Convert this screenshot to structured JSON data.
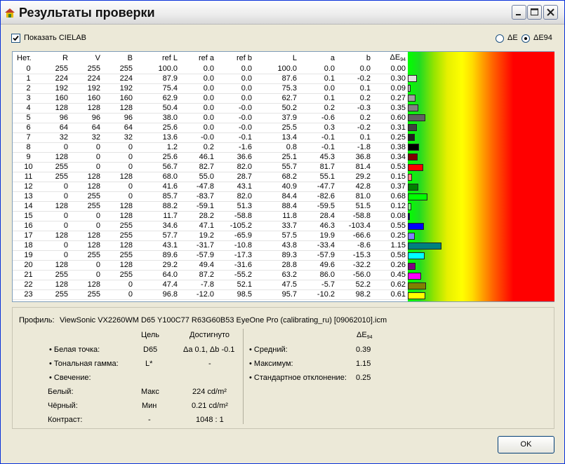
{
  "window": {
    "title": "Результаты проверки"
  },
  "options": {
    "show_cielab_label": "Показать CIELAB",
    "show_cielab_checked": true,
    "radio_de_label": "ΔE",
    "radio_de94_label": "ΔE94",
    "selected": "ΔE94"
  },
  "table": {
    "headers": [
      "Нет.",
      "R",
      "V",
      "B",
      "ref L",
      "ref a",
      "ref b",
      "L",
      "a",
      "b",
      "ΔE"
    ],
    "de_header_sub": "94",
    "rows": [
      [
        "0",
        "255",
        "255",
        "255",
        "100.0",
        "0.0",
        "0.0",
        "100.0",
        "0.0",
        "0.0",
        "0.00"
      ],
      [
        "1",
        "224",
        "224",
        "224",
        "87.9",
        "0.0",
        "0.0",
        "87.6",
        "0.1",
        "-0.2",
        "0.30"
      ],
      [
        "2",
        "192",
        "192",
        "192",
        "75.4",
        "0.0",
        "0.0",
        "75.3",
        "0.0",
        "0.1",
        "0.09"
      ],
      [
        "3",
        "160",
        "160",
        "160",
        "62.9",
        "0.0",
        "0.0",
        "62.7",
        "0.1",
        "0.2",
        "0.27"
      ],
      [
        "4",
        "128",
        "128",
        "128",
        "50.4",
        "0.0",
        "-0.0",
        "50.2",
        "0.2",
        "-0.3",
        "0.35"
      ],
      [
        "5",
        "96",
        "96",
        "96",
        "38.0",
        "0.0",
        "-0.0",
        "37.9",
        "-0.6",
        "0.2",
        "0.60"
      ],
      [
        "6",
        "64",
        "64",
        "64",
        "25.6",
        "0.0",
        "-0.0",
        "25.5",
        "0.3",
        "-0.2",
        "0.31"
      ],
      [
        "7",
        "32",
        "32",
        "32",
        "13.6",
        "-0.0",
        "-0.1",
        "13.4",
        "-0.1",
        "0.1",
        "0.25"
      ],
      [
        "8",
        "0",
        "0",
        "0",
        "1.2",
        "0.2",
        "-1.6",
        "0.8",
        "-0.1",
        "-1.8",
        "0.38"
      ],
      [
        "9",
        "128",
        "0",
        "0",
        "25.6",
        "46.1",
        "36.6",
        "25.1",
        "45.3",
        "36.8",
        "0.34"
      ],
      [
        "10",
        "255",
        "0",
        "0",
        "56.7",
        "82.7",
        "82.0",
        "55.7",
        "81.7",
        "81.4",
        "0.53"
      ],
      [
        "11",
        "255",
        "128",
        "128",
        "68.0",
        "55.0",
        "28.7",
        "68.2",
        "55.1",
        "29.2",
        "0.15"
      ],
      [
        "12",
        "0",
        "128",
        "0",
        "41.6",
        "-47.8",
        "43.1",
        "40.9",
        "-47.7",
        "42.8",
        "0.37"
      ],
      [
        "13",
        "0",
        "255",
        "0",
        "85.7",
        "-83.7",
        "82.0",
        "84.4",
        "-82.6",
        "81.0",
        "0.68"
      ],
      [
        "14",
        "128",
        "255",
        "128",
        "88.2",
        "-59.1",
        "51.3",
        "88.4",
        "-59.5",
        "51.5",
        "0.12"
      ],
      [
        "15",
        "0",
        "0",
        "128",
        "11.7",
        "28.2",
        "-58.8",
        "11.8",
        "28.4",
        "-58.8",
        "0.08"
      ],
      [
        "16",
        "0",
        "0",
        "255",
        "34.6",
        "47.1",
        "-105.2",
        "33.7",
        "46.3",
        "-103.4",
        "0.55"
      ],
      [
        "17",
        "128",
        "128",
        "255",
        "57.7",
        "19.2",
        "-65.9",
        "57.5",
        "19.9",
        "-66.6",
        "0.25"
      ],
      [
        "18",
        "0",
        "128",
        "128",
        "43.1",
        "-31.7",
        "-10.8",
        "43.8",
        "-33.4",
        "-8.6",
        "1.15"
      ],
      [
        "19",
        "0",
        "255",
        "255",
        "89.6",
        "-57.9",
        "-17.3",
        "89.3",
        "-57.9",
        "-15.3",
        "0.58"
      ],
      [
        "20",
        "128",
        "0",
        "128",
        "29.2",
        "49.4",
        "-31.6",
        "28.8",
        "49.6",
        "-32.2",
        "0.26"
      ],
      [
        "21",
        "255",
        "0",
        "255",
        "64.0",
        "87.2",
        "-55.2",
        "63.2",
        "86.0",
        "-56.0",
        "0.45"
      ],
      [
        "22",
        "128",
        "128",
        "0",
        "47.4",
        "-7.8",
        "52.1",
        "47.5",
        "-5.7",
        "52.2",
        "0.62"
      ],
      [
        "23",
        "255",
        "255",
        "0",
        "96.8",
        "-12.0",
        "98.5",
        "95.7",
        "-10.2",
        "98.2",
        "0.61"
      ]
    ],
    "de_scale_max": 5
  },
  "profile": {
    "label": "Профиль:",
    "value": "ViewSonic VX2260WM D65 Y100C77 R63G60B53 EyeOne Pro (calibrating_ru) [09062010].icm"
  },
  "summary": {
    "col_target": "Цель",
    "col_achieved": "Достигнуто",
    "white_point_label": "• Белая точка:",
    "white_point_target": "D65",
    "white_point_achieved": "Δa 0.1, Δb -0.1",
    "tone_label": "• Тональная гамма:",
    "tone_target": "L*",
    "tone_achieved": "-",
    "lum_label": "• Свечение:",
    "white_label": "Белый:",
    "white_target": "Макс",
    "white_achieved": "224 cd/m²",
    "black_label": "Чёрный:",
    "black_target": "Мин",
    "black_achieved": "0.21 cd/m²",
    "contrast_label": "Контраст:",
    "contrast_target": "-",
    "contrast_achieved": "1048 : 1",
    "de_header": "ΔE",
    "de_header_sub": "94",
    "avg_label": "• Средний:",
    "avg_value": "0.39",
    "max_label": "• Максимум:",
    "max_value": "1.15",
    "std_label": "• Стандартное отклонение:",
    "std_value": "0.25"
  },
  "buttons": {
    "ok": "OK"
  }
}
